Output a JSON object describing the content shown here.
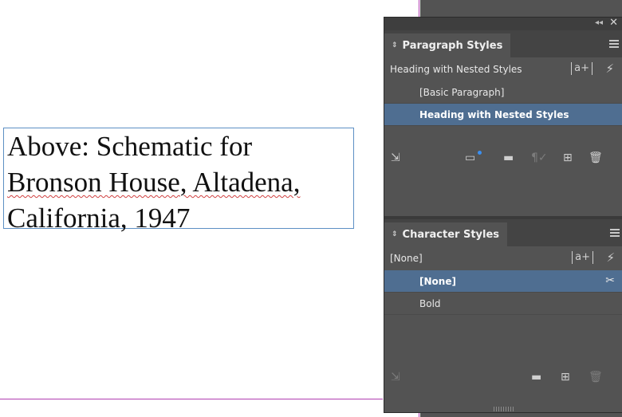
{
  "document": {
    "frame_lines": [
      "Above: Schematic for",
      "Bronson House, Altadena,",
      "California, 1947"
    ]
  },
  "paragraph_panel": {
    "title": "Paragraph Styles",
    "current_style": "Heading with Nested Styles",
    "new_style_glyph": "a+",
    "items": [
      {
        "label": "[Basic Paragraph]",
        "selected": false
      },
      {
        "label": "Heading with Nested Styles",
        "selected": true
      }
    ]
  },
  "character_panel": {
    "title": "Character Styles",
    "current_style": "[None]",
    "new_style_glyph": "a+",
    "items": [
      {
        "label": "[None]",
        "selected": true
      },
      {
        "label": "Bold",
        "selected": false
      }
    ]
  },
  "colors": {
    "selection": "#4f6e91",
    "panel_bg": "#535353",
    "guide": "#b03cb0",
    "frame_border": "#5d8fc4"
  }
}
